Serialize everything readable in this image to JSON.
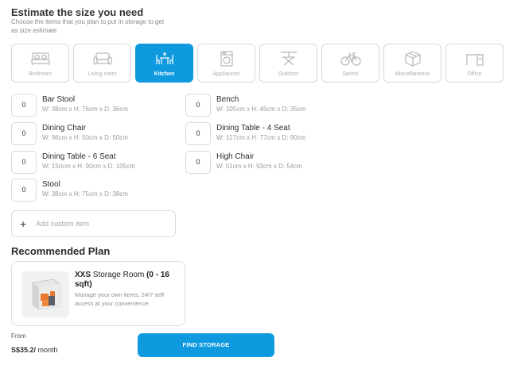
{
  "header": {
    "title": "Estimate the size you need",
    "subtitle": "Choose the items that you plan to put in storage to get as size estimate"
  },
  "categories": [
    {
      "label": "Bedroom",
      "icon": "bed-icon",
      "active": false
    },
    {
      "label": "Living room",
      "icon": "sofa-icon",
      "active": false
    },
    {
      "label": "Kitchen",
      "icon": "dining-table-icon",
      "active": true
    },
    {
      "label": "Appliances",
      "icon": "washing-machine-icon",
      "active": false
    },
    {
      "label": "Outdoor",
      "icon": "patio-table-icon",
      "active": false
    },
    {
      "label": "Sports",
      "icon": "bicycle-icon",
      "active": false
    },
    {
      "label": "Miscellaneous",
      "icon": "box-icon",
      "active": false
    },
    {
      "label": "Office",
      "icon": "desk-icon",
      "active": false
    }
  ],
  "items": [
    {
      "name": "Bar Stool",
      "dims": "W: 38cm x H: 76cm x D: 36cm",
      "qty": "0"
    },
    {
      "name": "Bench",
      "dims": "W: 105cm x H: 45cm x D: 35cm",
      "qty": "0"
    },
    {
      "name": "Dining Chair",
      "dims": "W: 96cm x H: 50cm x D: 50cm",
      "qty": "0"
    },
    {
      "name": "Dining Table - 4 Seat",
      "dims": "W: 127cm x H: 77cm x D: 90cm",
      "qty": "0"
    },
    {
      "name": "Dining Table - 6 Seat",
      "dims": "W: 150cm x H: 90cm x D: 105cm",
      "qty": "0"
    },
    {
      "name": "High Chair",
      "dims": "W: 51cm x H: 93cm x D: 54cm",
      "qty": "0"
    },
    {
      "name": "Stool",
      "dims": "W: 38cm x H: 75cm x D: 38cm",
      "qty": "0"
    }
  ],
  "custom_item": {
    "plus": "+",
    "placeholder": "Add custom item"
  },
  "recommended": {
    "title": "Recommended Plan",
    "plan_size": "XXS",
    "plan_name": " Storage Room ",
    "plan_range": "(0 - 16 sqft)",
    "plan_desc": "Manage your own items, 24/7 self access at your convenience."
  },
  "pricing": {
    "from_label": "From",
    "price": "S$35.2/",
    "period": " month"
  },
  "cta": {
    "label": "FIND STORAGE"
  },
  "colors": {
    "accent": "#0f9ae0",
    "border": "#d6d6d6",
    "icon_gray": "#b8b8b8"
  }
}
